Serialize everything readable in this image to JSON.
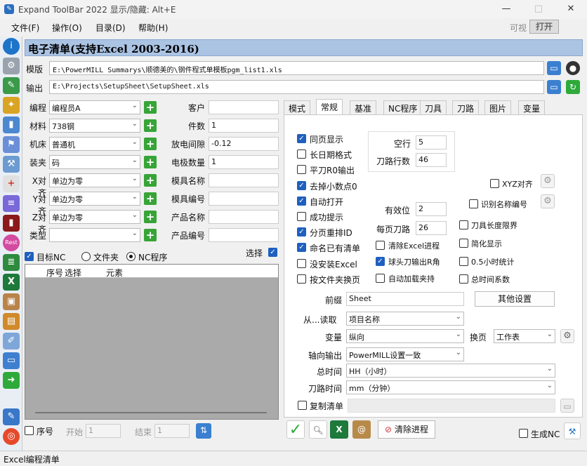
{
  "window": {
    "title": "Expand ToolBar 2022 显示/隐藏: Alt+E",
    "min": "—",
    "max": "□",
    "close": "✕"
  },
  "menu": [
    "文件(F)",
    "操作(O)",
    "目录(D)",
    "帮助(H)"
  ],
  "visibility": {
    "label": "可视",
    "button": "打开"
  },
  "header_title": "电子清单(支持Excel 2003-2016)",
  "template": {
    "label": "模版",
    "path": "E:\\PowerMILL Summarys\\顺德美的\\钢件程式单模板pgm_list1.xls"
  },
  "output": {
    "label": "输出",
    "path": "E:\\Projects\\SetupSheet\\SetupSheet.xls"
  },
  "form_left": [
    {
      "label": "编程",
      "value": "编程员A"
    },
    {
      "label": "材料",
      "value": "738钢"
    },
    {
      "label": "机床",
      "value": "普通机"
    },
    {
      "label": "装夹",
      "value": "码"
    },
    {
      "label": "X对齐",
      "value": "单边为零"
    },
    {
      "label": "Y对齐",
      "value": "单边为零"
    },
    {
      "label": "Z对齐",
      "value": "单边为零"
    },
    {
      "label": "类型",
      "value": ""
    }
  ],
  "form_right": [
    {
      "label": "客户",
      "value": ""
    },
    {
      "label": "件数",
      "value": "1"
    },
    {
      "label": "放电间隙",
      "value": "-0.12"
    },
    {
      "label": "电极数量",
      "value": "1"
    },
    {
      "label": "模具名称",
      "value": ""
    },
    {
      "label": "模具编号",
      "value": ""
    },
    {
      "label": "产品名称",
      "value": ""
    },
    {
      "label": "产品编号",
      "value": ""
    }
  ],
  "target": {
    "checkbox": "目标NC",
    "radio_folder": "文件夹",
    "radio_nc": "NC程序",
    "select": "选择"
  },
  "list_columns": [
    "序号",
    "选择",
    "元素"
  ],
  "bottom_left": {
    "seq": "序号",
    "start_label": "开始",
    "start_value": "1",
    "end_label": "结束",
    "end_value": "1"
  },
  "tabs": [
    "模式",
    "常规",
    "基准",
    "NC程序",
    "刀具",
    "刀路",
    "图片",
    "变量"
  ],
  "active_tab": "常规",
  "options_left": [
    {
      "label": "同页显示",
      "checked": true
    },
    {
      "label": "长日期格式",
      "checked": false
    },
    {
      "label": "平刀R0输出",
      "checked": false
    },
    {
      "label": "去掉小数点0",
      "checked": true
    },
    {
      "label": "自动打开",
      "checked": true
    },
    {
      "label": "成功提示",
      "checked": false
    },
    {
      "label": "分页重排ID",
      "checked": true
    },
    {
      "label": "命名已有清单",
      "checked": true
    },
    {
      "label": "没安装Excel",
      "checked": false
    },
    {
      "label": "按文件夹换页",
      "checked": false
    }
  ],
  "fields": {
    "empty_rows": {
      "label": "空行",
      "value": "5"
    },
    "path_rows": {
      "label": "刀路行数",
      "value": "46"
    },
    "decimals": {
      "label": "有效位",
      "value": "2"
    },
    "paths_per_page": {
      "label": "每页刀路",
      "value": "26"
    }
  },
  "options_mid": [
    {
      "label": "清除Excel进程",
      "checked": false
    },
    {
      "label": "球头刀输出R角",
      "checked": true
    },
    {
      "label": "自动加载夹持",
      "checked": false
    }
  ],
  "options_right": [
    {
      "label": "XYZ对齐",
      "checked": false
    },
    {
      "label": "识别名称编号",
      "checked": false
    },
    {
      "label": "刀具长度限界",
      "checked": false
    },
    {
      "label": "简化显示",
      "checked": false
    },
    {
      "label": "0.5小时统计",
      "checked": false
    },
    {
      "label": "总时间系数",
      "checked": false
    }
  ],
  "prefix": {
    "label": "前缀",
    "value": "Sheet",
    "other_button": "其他设置"
  },
  "read_from": {
    "label": "从...读取",
    "value": "项目名称"
  },
  "variable": {
    "label": "变量",
    "value": "纵向",
    "page_label": "换页",
    "page_value": "工作表"
  },
  "axis_output": {
    "label": "轴向输出",
    "value": "PowerMILL设置一致"
  },
  "total_time": {
    "label": "总时间",
    "value": "HH（小时）"
  },
  "path_time": {
    "label": "刀路时间",
    "value": "mm（分钟）"
  },
  "copy_list": {
    "label": "复制清单",
    "checked": false
  },
  "actions": {
    "clear_process": "清除进程",
    "generate_nc": "生成NC"
  },
  "status": "Excel编程清单"
}
